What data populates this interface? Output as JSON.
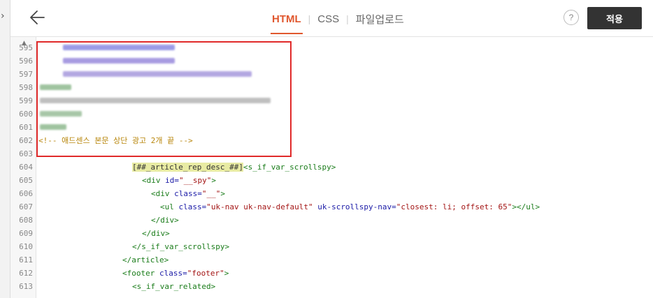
{
  "rail": {
    "chevron": "›"
  },
  "header": {
    "tabs": [
      {
        "label": "HTML",
        "active": true
      },
      {
        "label": "CSS",
        "active": false
      },
      {
        "label": "파일업로드",
        "active": false
      }
    ],
    "help_label": "?",
    "apply_label": "적용"
  },
  "colors": {
    "accent": "#e0572e",
    "apply_bg": "#333333",
    "highlight_border": "#e02a2a"
  },
  "editor": {
    "lines": [
      {
        "n": "595"
      },
      {
        "n": "596"
      },
      {
        "n": "597"
      },
      {
        "n": "598"
      },
      {
        "n": "599"
      },
      {
        "n": "600"
      },
      {
        "n": "601"
      },
      {
        "n": "602",
        "comment": "<!-- 애드센스 본문 상단 광고 2개 끝 -->"
      },
      {
        "n": "603"
      },
      {
        "n": "604",
        "hl": "[##_article_rep_desc_##]",
        "tag": "<s_if_var_scrollspy>"
      },
      {
        "n": "605",
        "open": "<div ",
        "attr": "id=",
        "str": "\"__spy\"",
        "close": ">"
      },
      {
        "n": "606",
        "open": "<div ",
        "attr": "class=",
        "str": "\"__\"",
        "close": ">"
      },
      {
        "n": "607",
        "open": "<ul ",
        "attr": "class=",
        "str": "\"uk-nav uk-nav-default\"",
        "attr2": " uk-scrollspy-nav=",
        "str2": "\"closest: li; offset: 65\"",
        "close": "></ul>"
      },
      {
        "n": "608",
        "tag": "</div>"
      },
      {
        "n": "609",
        "tag": "</div>"
      },
      {
        "n": "610",
        "tag": "</s_if_var_scrollspy>"
      },
      {
        "n": "611",
        "tag": "</article>"
      },
      {
        "n": "612",
        "open": "<footer ",
        "attr": "class=",
        "str": "\"footer\"",
        "close": ">"
      },
      {
        "n": "613",
        "tag": "<s_if_var_related>"
      }
    ]
  }
}
